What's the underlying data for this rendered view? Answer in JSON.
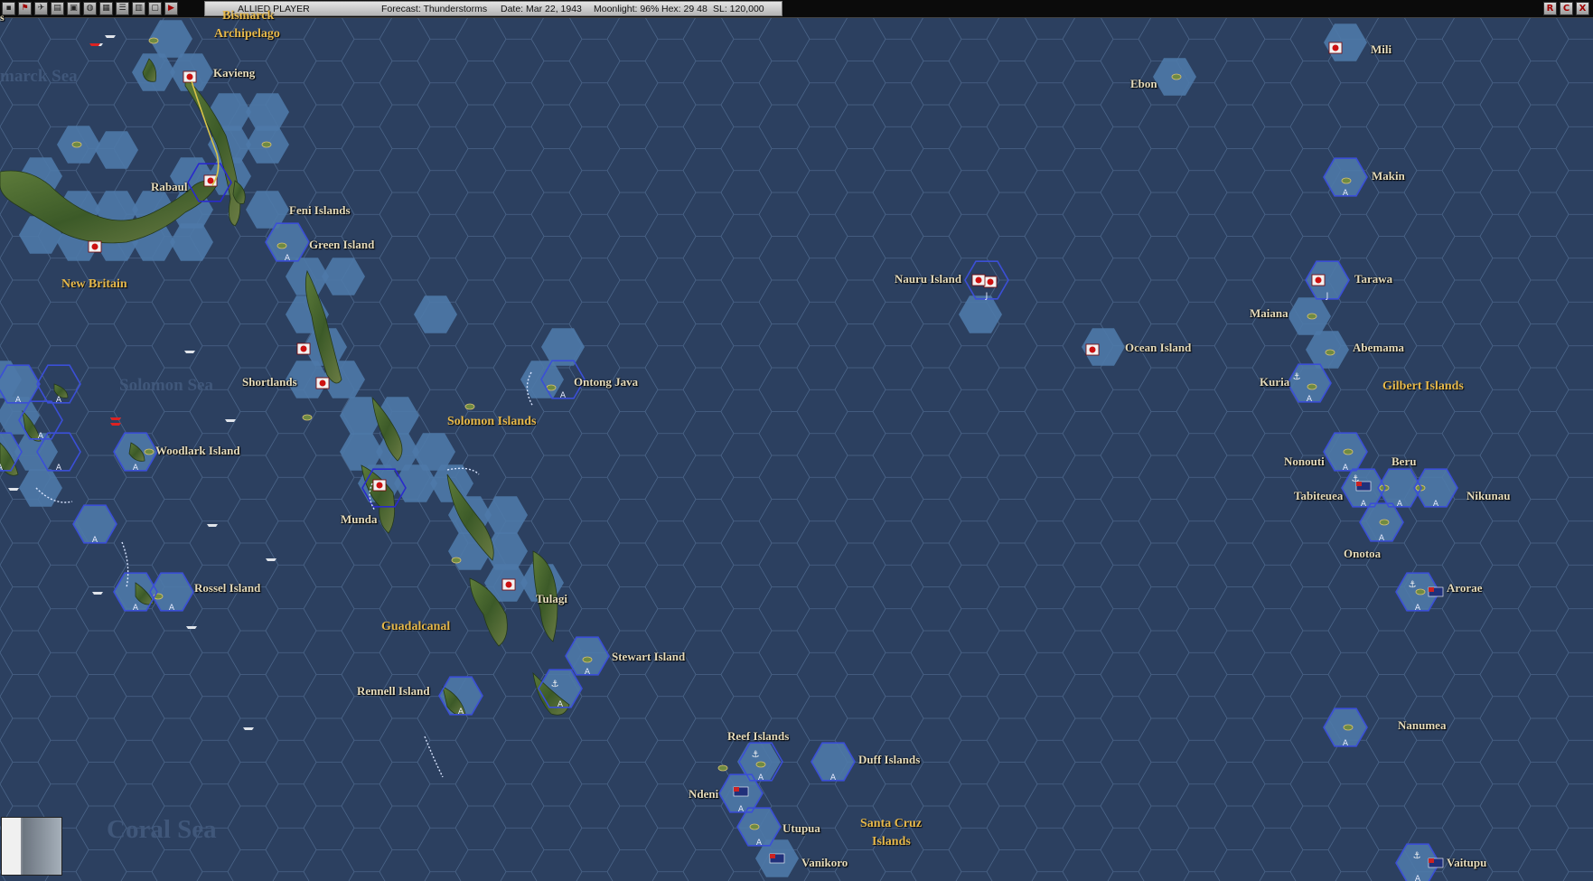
{
  "toolbar": {
    "icons": [
      "flag-icon",
      "ship-icon",
      "plane-icon",
      "factory-icon",
      "base-icon",
      "globe-icon",
      "report-icon",
      "list-icon",
      "settings-icon",
      "window-icon",
      "end-turn-icon"
    ],
    "player": "ALLIED PLAYER",
    "forecast": "Forecast: Thunderstorms",
    "date": "Date: Mar 22, 1943",
    "moonlight": "Moonlight: 96%",
    "hex": "Hex: 29 48",
    "sl": "SL: 120,000",
    "window_buttons": [
      "R",
      "C",
      "X"
    ]
  },
  "colors": {
    "ocean": "#2c4060",
    "hex_line": "#4a6488",
    "shallow": "#4f7aaa",
    "land": "#3f5e2c",
    "allied": "#3b4fd6",
    "japanese": "#cc1111",
    "region_label": "#e6b84a",
    "place_label": "#e6dcbc"
  },
  "map": {
    "places": {
      "bismarck": "Bismarck",
      "kavieng": "Kavieng",
      "rabaul": "Rabaul",
      "feni": "Feni Islands",
      "green": "Green Island",
      "shortlands": "Shortlands",
      "woodlark": "Woodlark Island",
      "munda": "Munda",
      "ontong": "Ontong Java",
      "rossel": "Rossel Island",
      "tulagi": "Tulagi",
      "stewart": "Stewart Island",
      "rennell": "Rennell Island",
      "reef": "Reef Islands",
      "duff": "Duff Islands",
      "ndeni": "Ndeni",
      "utupua": "Utupua",
      "vanikoro": "Vanikoro",
      "nauru": "Nauru Island",
      "ocean": "Ocean Island",
      "ebon": "Ebon",
      "mili": "Mili",
      "makin": "Makin",
      "tarawa": "Tarawa",
      "maiana": "Maiana",
      "abemama": "Abemama",
      "kuria": "Kuria",
      "nonouti": "Nonouti",
      "beru": "Beru",
      "tabiteuea": "Tabiteuea",
      "nikunau": "Nikunau",
      "onotoa": "Onotoa",
      "arorae": "Arorae",
      "nanumea": "Nanumea",
      "vaitupu": "Vaitupu"
    },
    "regions": {
      "archipelago": "Archipelago",
      "new_britain": "New Britain",
      "solomon_islands": "Solomon Islands",
      "guadalcanal": "Guadalcanal",
      "santa_cruz": "Santa Cruz",
      "santa_cruz_2": "Islands",
      "gilbert": "Gilbert Islands"
    },
    "seas": {
      "bismarck_sea": "marck Sea",
      "solomon_sea": "Solomon Sea",
      "coral_sea": "Coral Sea"
    },
    "edge_letter": "s",
    "hex_marker": "A",
    "hex_marker_j": "J"
  }
}
